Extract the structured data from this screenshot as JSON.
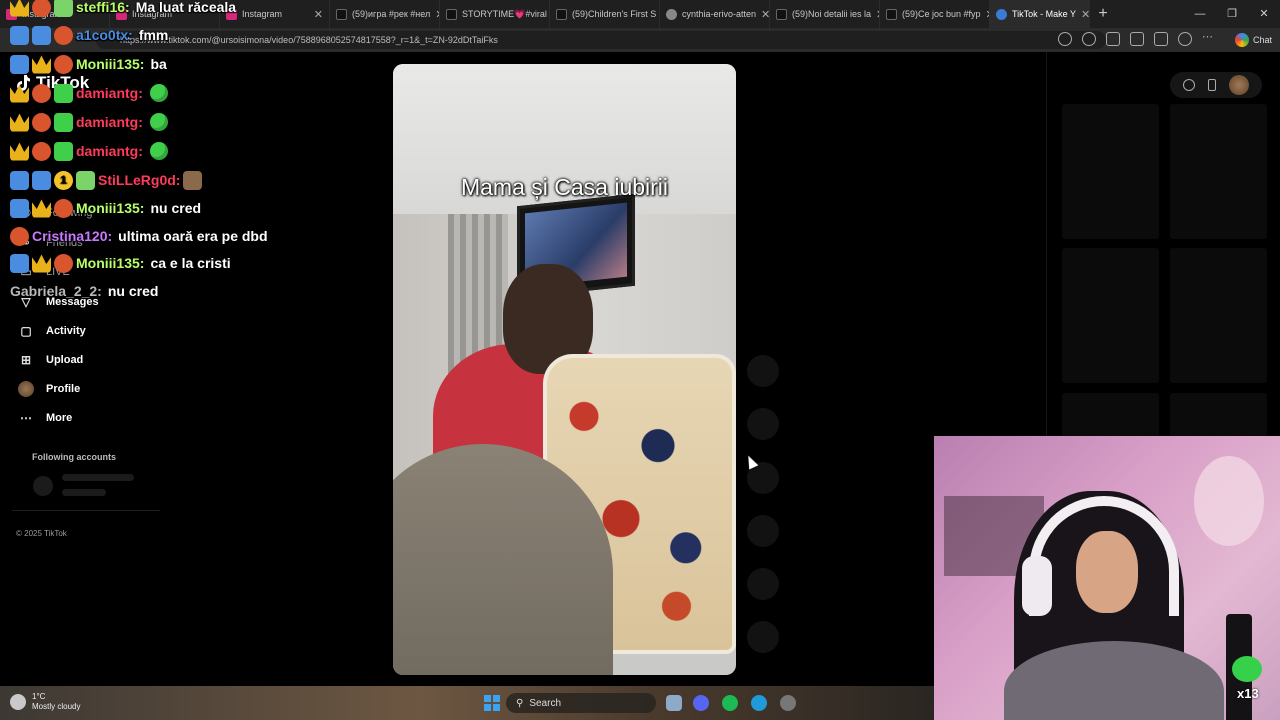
{
  "browser": {
    "tabs": [
      {
        "title": "Instagram",
        "favicon_color": "#d6287a"
      },
      {
        "title": "Instagram",
        "favicon_color": "#d6287a"
      },
      {
        "title": "Instagram",
        "favicon_color": "#d6287a"
      },
      {
        "title": "(59)игра #рек #нел",
        "favicon_color": "#111111"
      },
      {
        "title": "STORYTIME💗#viral",
        "favicon_color": "#111111"
      },
      {
        "title": "(59)Children's First S",
        "favicon_color": "#111111"
      },
      {
        "title": "cynthia-erivo-atten",
        "favicon_color": "#888888"
      },
      {
        "title": "(59)Noi detalii ies la",
        "favicon_color": "#111111"
      },
      {
        "title": "(59)Ce joc bun #fyp",
        "favicon_color": "#111111"
      },
      {
        "title": "TikTok - Make Y",
        "favicon_color": "#3a7bd5",
        "active": true
      }
    ],
    "url": "https://www.tiktok.com/@ursoisimona/video/7588968052574817558?_r=1&_t=ZN-92dDtTaiFks",
    "chat_label": "Chat"
  },
  "sidebar": {
    "logo": "TikTok",
    "items": [
      {
        "label": "Following",
        "icon": "following-icon"
      },
      {
        "label": "Friends",
        "icon": "friends-icon"
      },
      {
        "label": "LIVE",
        "icon": "live-icon"
      },
      {
        "label": "Messages",
        "icon": "messages-icon"
      },
      {
        "label": "Activity",
        "icon": "activity-icon"
      },
      {
        "label": "Upload",
        "icon": "upload-icon"
      },
      {
        "label": "Profile",
        "icon": "profile-avatar"
      },
      {
        "label": "More",
        "icon": "more-icon"
      }
    ],
    "following_accounts": "Following accounts",
    "copyright": "© 2025 TikTok"
  },
  "video": {
    "caption": "Mama și Casa iubirii"
  },
  "chat_overlay": [
    {
      "user": "steffi16:",
      "message": "Ma luat răceala",
      "color": "#b8ff6a"
    },
    {
      "user": "a1co0tx:",
      "message": "fmm",
      "color": "#4a8de0"
    },
    {
      "user": "Moniii135:",
      "message": "ba",
      "color": "#b8ff6a"
    },
    {
      "user": "damiantg:",
      "message": "",
      "color": "#ff3b5b"
    },
    {
      "user": "damiantg:",
      "message": "",
      "color": "#ff3b5b"
    },
    {
      "user": "damiantg:",
      "message": "",
      "color": "#ff3b5b"
    },
    {
      "user": "StiLLeRg0d:",
      "message": "",
      "color": "#ff3b5b",
      "tier": "1"
    },
    {
      "user": "Moniii135:",
      "message": "nu cred",
      "color": "#b8ff6a"
    },
    {
      "user": "Cristina120:",
      "message": "ultima oară era pe dbd",
      "color": "#c979ff"
    },
    {
      "user": "Moniii135:",
      "message": "ca e la cristi",
      "color": "#b8ff6a"
    },
    {
      "user": "Gabriela_2_2:",
      "message": "nu cred",
      "color": "#b9b9b9"
    }
  ],
  "webcam": {
    "badge": "x13"
  },
  "taskbar": {
    "temperature": "1°C",
    "weather": "Mostly cloudy",
    "search": "Search"
  }
}
